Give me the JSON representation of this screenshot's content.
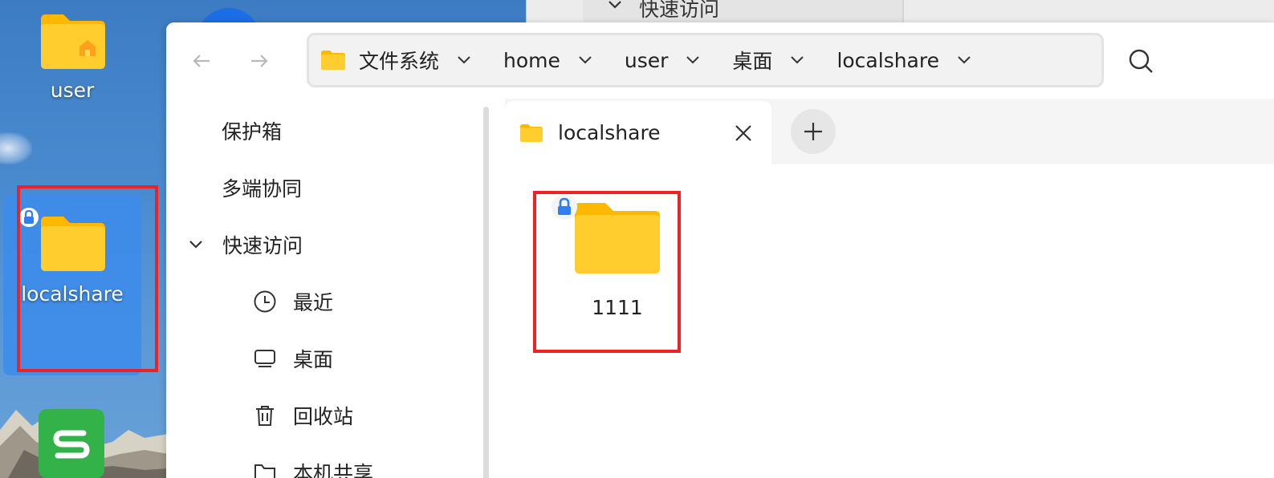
{
  "desktop": {
    "icons": [
      {
        "label": "user",
        "icon": "home-folder-icon"
      },
      {
        "label": "localshare",
        "icon": "locked-folder-icon",
        "selected": true
      }
    ],
    "highlight_color": "#ee2222"
  },
  "background_window": {
    "sidebar_item": "快速访问"
  },
  "window": {
    "breadcrumb": [
      {
        "label": "文件系统",
        "icon": "folder-icon"
      },
      {
        "label": "home"
      },
      {
        "label": "user"
      },
      {
        "label": "桌面"
      },
      {
        "label": "localshare"
      }
    ],
    "sidebar": {
      "items": [
        {
          "label": "保护箱"
        },
        {
          "label": "多端协同"
        },
        {
          "label": "快速访问",
          "expanded": true
        },
        {
          "label": "最近",
          "icon": "clock-icon"
        },
        {
          "label": "桌面",
          "icon": "monitor-icon"
        },
        {
          "label": "回收站",
          "icon": "trash-icon"
        },
        {
          "label": "本机共享",
          "icon": "shared-folder-icon"
        }
      ]
    },
    "tabs": [
      {
        "label": "localshare",
        "icon": "folder-icon",
        "active": true
      }
    ],
    "files": [
      {
        "name": "1111",
        "icon": "locked-folder-icon"
      }
    ]
  },
  "colors": {
    "folder": "#ffc21a",
    "accent": "#2f7ff0",
    "selection": "#3c8ceb"
  }
}
